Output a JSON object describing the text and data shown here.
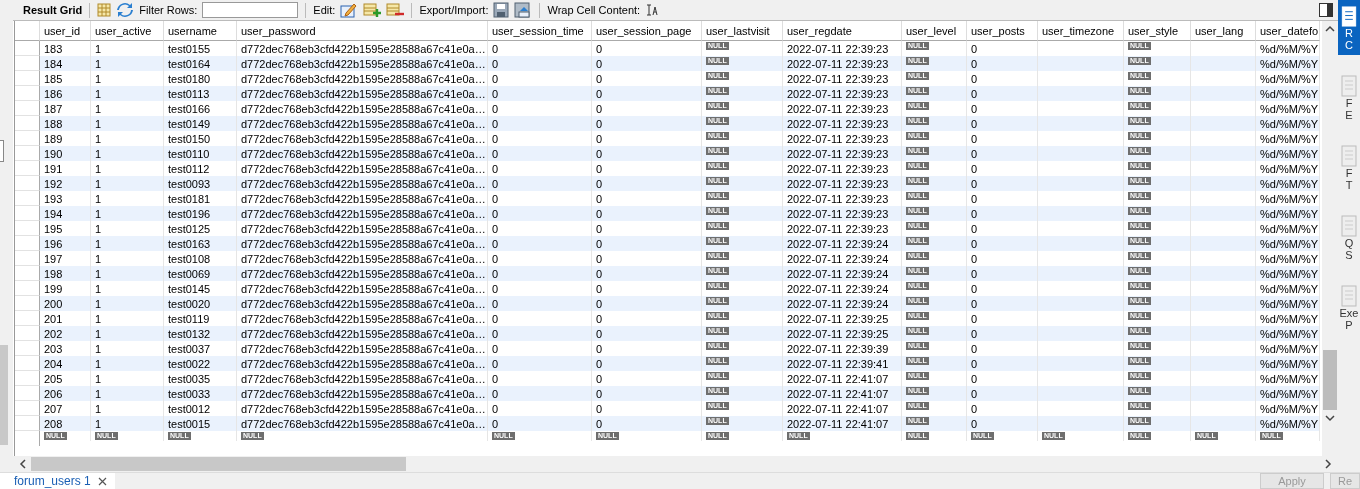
{
  "toolbar": {
    "title": "Result Grid",
    "filter_label": "Filter Rows:",
    "edit_label": "Edit:",
    "export_label": "Export/Import:",
    "wrap_label": "Wrap Cell Content:"
  },
  "columns": [
    "user_id",
    "user_active",
    "username",
    "user_password",
    "user_session_time",
    "user_session_page",
    "user_lastvisit",
    "user_regdate",
    "user_level",
    "user_posts",
    "user_timezone",
    "user_style",
    "user_lang",
    "user_datefo"
  ],
  "rows": [
    [
      "183",
      "1",
      "test0155",
      "d772dec768eb3cfd422b1595e28588a67c41e0a…",
      "0",
      "0",
      {
        "kind": "null",
        "text": "NULL"
      },
      "2022-07-11 22:39:23",
      {
        "kind": "null",
        "text": "NULL"
      },
      "0",
      null,
      {
        "kind": "null",
        "text": "NULL"
      },
      null,
      "%d/%M/%Y"
    ],
    [
      "184",
      "1",
      "test0164",
      "d772dec768eb3cfd422b1595e28588a67c41e0a…",
      "0",
      "0",
      {
        "kind": "null",
        "text": "NULL"
      },
      "2022-07-11 22:39:23",
      {
        "kind": "null",
        "text": "NULL"
      },
      "0",
      null,
      {
        "kind": "null",
        "text": "NULL"
      },
      null,
      "%d/%M/%Y"
    ],
    [
      "185",
      "1",
      "test0180",
      "d772dec768eb3cfd422b1595e28588a67c41e0a…",
      "0",
      "0",
      {
        "kind": "null",
        "text": "NULL"
      },
      "2022-07-11 22:39:23",
      {
        "kind": "null",
        "text": "NULL"
      },
      "0",
      null,
      {
        "kind": "null",
        "text": "NULL"
      },
      null,
      "%d/%M/%Y"
    ],
    [
      "186",
      "1",
      "test0113",
      "d772dec768eb3cfd422b1595e28588a67c41e0a…",
      "0",
      "0",
      {
        "kind": "null",
        "text": "NULL"
      },
      "2022-07-11 22:39:23",
      {
        "kind": "null",
        "text": "NULL"
      },
      "0",
      null,
      {
        "kind": "null",
        "text": "NULL"
      },
      null,
      "%d/%M/%Y"
    ],
    [
      "187",
      "1",
      "test0166",
      "d772dec768eb3cfd422b1595e28588a67c41e0a…",
      "0",
      "0",
      {
        "kind": "null",
        "text": "NULL"
      },
      "2022-07-11 22:39:23",
      {
        "kind": "null",
        "text": "NULL"
      },
      "0",
      null,
      {
        "kind": "null",
        "text": "NULL"
      },
      null,
      "%d/%M/%Y"
    ],
    [
      "188",
      "1",
      "test0149",
      "d772dec768eb3cfd422b1595e28588a67c41e0a…",
      "0",
      "0",
      {
        "kind": "null",
        "text": "NULL"
      },
      "2022-07-11 22:39:23",
      {
        "kind": "null",
        "text": "NULL"
      },
      "0",
      null,
      {
        "kind": "null",
        "text": "NULL"
      },
      null,
      "%d/%M/%Y"
    ],
    [
      "189",
      "1",
      "test0150",
      "d772dec768eb3cfd422b1595e28588a67c41e0a…",
      "0",
      "0",
      {
        "kind": "null",
        "text": "NULL"
      },
      "2022-07-11 22:39:23",
      {
        "kind": "null",
        "text": "NULL"
      },
      "0",
      null,
      {
        "kind": "null",
        "text": "NULL"
      },
      null,
      "%d/%M/%Y"
    ],
    [
      "190",
      "1",
      "test0110",
      "d772dec768eb3cfd422b1595e28588a67c41e0a…",
      "0",
      "0",
      {
        "kind": "null",
        "text": "NULL"
      },
      "2022-07-11 22:39:23",
      {
        "kind": "null",
        "text": "NULL"
      },
      "0",
      null,
      {
        "kind": "null",
        "text": "NULL"
      },
      null,
      "%d/%M/%Y"
    ],
    [
      "191",
      "1",
      "test0112",
      "d772dec768eb3cfd422b1595e28588a67c41e0a…",
      "0",
      "0",
      {
        "kind": "null",
        "text": "NULL"
      },
      "2022-07-11 22:39:23",
      {
        "kind": "null",
        "text": "NULL"
      },
      "0",
      null,
      {
        "kind": "null",
        "text": "NULL"
      },
      null,
      "%d/%M/%Y"
    ],
    [
      "192",
      "1",
      "test0093",
      "d772dec768eb3cfd422b1595e28588a67c41e0a…",
      "0",
      "0",
      {
        "kind": "null",
        "text": "NULL"
      },
      "2022-07-11 22:39:23",
      {
        "kind": "null",
        "text": "NULL"
      },
      "0",
      null,
      {
        "kind": "null",
        "text": "NULL"
      },
      null,
      "%d/%M/%Y"
    ],
    [
      "193",
      "1",
      "test0181",
      "d772dec768eb3cfd422b1595e28588a67c41e0a…",
      "0",
      "0",
      {
        "kind": "null",
        "text": "NULL"
      },
      "2022-07-11 22:39:23",
      {
        "kind": "null",
        "text": "NULL"
      },
      "0",
      null,
      {
        "kind": "null",
        "text": "NULL"
      },
      null,
      "%d/%M/%Y"
    ],
    [
      "194",
      "1",
      "test0196",
      "d772dec768eb3cfd422b1595e28588a67c41e0a…",
      "0",
      "0",
      {
        "kind": "null",
        "text": "NULL"
      },
      "2022-07-11 22:39:23",
      {
        "kind": "null",
        "text": "NULL"
      },
      "0",
      null,
      {
        "kind": "null",
        "text": "NULL"
      },
      null,
      "%d/%M/%Y"
    ],
    [
      "195",
      "1",
      "test0125",
      "d772dec768eb3cfd422b1595e28588a67c41e0a…",
      "0",
      "0",
      {
        "kind": "null",
        "text": "NULL"
      },
      "2022-07-11 22:39:23",
      {
        "kind": "null",
        "text": "NULL"
      },
      "0",
      null,
      {
        "kind": "null",
        "text": "NULL"
      },
      null,
      "%d/%M/%Y"
    ],
    [
      "196",
      "1",
      "test0163",
      "d772dec768eb3cfd422b1595e28588a67c41e0a…",
      "0",
      "0",
      {
        "kind": "null",
        "text": "NULL"
      },
      "2022-07-11 22:39:24",
      {
        "kind": "null",
        "text": "NULL"
      },
      "0",
      null,
      {
        "kind": "null",
        "text": "NULL"
      },
      null,
      "%d/%M/%Y"
    ],
    [
      "197",
      "1",
      "test0108",
      "d772dec768eb3cfd422b1595e28588a67c41e0a…",
      "0",
      "0",
      {
        "kind": "null",
        "text": "NULL"
      },
      "2022-07-11 22:39:24",
      {
        "kind": "null",
        "text": "NULL"
      },
      "0",
      null,
      {
        "kind": "null",
        "text": "NULL"
      },
      null,
      "%d/%M/%Y"
    ],
    [
      "198",
      "1",
      "test0069",
      "d772dec768eb3cfd422b1595e28588a67c41e0a…",
      "0",
      "0",
      {
        "kind": "null",
        "text": "NULL"
      },
      "2022-07-11 22:39:24",
      {
        "kind": "null",
        "text": "NULL"
      },
      "0",
      null,
      {
        "kind": "null",
        "text": "NULL"
      },
      null,
      "%d/%M/%Y"
    ],
    [
      "199",
      "1",
      "test0145",
      "d772dec768eb3cfd422b1595e28588a67c41e0a…",
      "0",
      "0",
      {
        "kind": "null",
        "text": "NULL"
      },
      "2022-07-11 22:39:24",
      {
        "kind": "null",
        "text": "NULL"
      },
      "0",
      null,
      {
        "kind": "null",
        "text": "NULL"
      },
      null,
      "%d/%M/%Y"
    ],
    [
      "200",
      "1",
      "test0020",
      "d772dec768eb3cfd422b1595e28588a67c41e0a…",
      "0",
      "0",
      {
        "kind": "null",
        "text": "NULL"
      },
      "2022-07-11 22:39:24",
      {
        "kind": "null",
        "text": "NULL"
      },
      "0",
      null,
      {
        "kind": "null",
        "text": "NULL"
      },
      null,
      "%d/%M/%Y"
    ],
    [
      "201",
      "1",
      "test0119",
      "d772dec768eb3cfd422b1595e28588a67c41e0a…",
      "0",
      "0",
      {
        "kind": "null",
        "text": "NULL"
      },
      "2022-07-11 22:39:25",
      {
        "kind": "null",
        "text": "NULL"
      },
      "0",
      null,
      {
        "kind": "null",
        "text": "NULL"
      },
      null,
      "%d/%M/%Y"
    ],
    [
      "202",
      "1",
      "test0132",
      "d772dec768eb3cfd422b1595e28588a67c41e0a…",
      "0",
      "0",
      {
        "kind": "null",
        "text": "NULL"
      },
      "2022-07-11 22:39:25",
      {
        "kind": "null",
        "text": "NULL"
      },
      "0",
      null,
      {
        "kind": "null",
        "text": "NULL"
      },
      null,
      "%d/%M/%Y"
    ],
    [
      "203",
      "1",
      "test0037",
      "d772dec768eb3cfd422b1595e28588a67c41e0a…",
      "0",
      "0",
      {
        "kind": "null",
        "text": "NULL"
      },
      "2022-07-11 22:39:39",
      {
        "kind": "null",
        "text": "NULL"
      },
      "0",
      null,
      {
        "kind": "null",
        "text": "NULL"
      },
      null,
      "%d/%M/%Y"
    ],
    [
      "204",
      "1",
      "test0022",
      "d772dec768eb3cfd422b1595e28588a67c41e0a…",
      "0",
      "0",
      {
        "kind": "null",
        "text": "NULL"
      },
      "2022-07-11 22:39:41",
      {
        "kind": "null",
        "text": "NULL"
      },
      "0",
      null,
      {
        "kind": "null",
        "text": "NULL"
      },
      null,
      "%d/%M/%Y"
    ],
    [
      "205",
      "1",
      "test0035",
      "d772dec768eb3cfd422b1595e28588a67c41e0a…",
      "0",
      "0",
      {
        "kind": "null",
        "text": "NULL"
      },
      "2022-07-11 22:41:07",
      {
        "kind": "null",
        "text": "NULL"
      },
      "0",
      null,
      {
        "kind": "null",
        "text": "NULL"
      },
      null,
      "%d/%M/%Y"
    ],
    [
      "206",
      "1",
      "test0033",
      "d772dec768eb3cfd422b1595e28588a67c41e0a…",
      "0",
      "0",
      {
        "kind": "null",
        "text": "NULL"
      },
      "2022-07-11 22:41:07",
      {
        "kind": "null",
        "text": "NULL"
      },
      "0",
      null,
      {
        "kind": "null",
        "text": "NULL"
      },
      null,
      "%d/%M/%Y"
    ],
    [
      "207",
      "1",
      "test0012",
      "d772dec768eb3cfd422b1595e28588a67c41e0a…",
      "0",
      "0",
      {
        "kind": "null",
        "text": "NULL"
      },
      "2022-07-11 22:41:07",
      {
        "kind": "null",
        "text": "NULL"
      },
      "0",
      null,
      {
        "kind": "null",
        "text": "NULL"
      },
      null,
      "%d/%M/%Y"
    ],
    [
      "208",
      "1",
      "test0015",
      "d772dec768eb3cfd422b1595e28588a67c41e0a…",
      "0",
      "0",
      {
        "kind": "null",
        "text": "NULL"
      },
      "2022-07-11 22:41:07",
      {
        "kind": "null",
        "text": "NULL"
      },
      "0",
      null,
      {
        "kind": "null",
        "text": "NULL"
      },
      null,
      "%d/%M/%Y"
    ],
    [
      {
        "kind": "null",
        "text": "NULL"
      },
      {
        "kind": "null",
        "text": "NULL"
      },
      {
        "kind": "null",
        "text": "NULL"
      },
      {
        "kind": "null",
        "text": "NULL"
      },
      {
        "kind": "null",
        "text": "NULL"
      },
      {
        "kind": "null",
        "text": "NULL"
      },
      {
        "kind": "null",
        "text": "NULL"
      },
      {
        "kind": "null",
        "text": "NULL"
      },
      {
        "kind": "null",
        "text": "NULL"
      },
      {
        "kind": "null",
        "text": "NULL"
      },
      {
        "kind": "null",
        "text": "NULL"
      },
      {
        "kind": "null",
        "text": "NULL"
      },
      {
        "kind": "null",
        "text": "NULL"
      },
      {
        "kind": "null",
        "text": "NULL"
      }
    ]
  ],
  "tabs": [
    {
      "label": "forum_users 1",
      "selected": true
    }
  ],
  "buttons": [
    {
      "label": "Apply",
      "disabled": true
    },
    {
      "label": "Re",
      "disabled": true
    }
  ],
  "side_panel": [
    {
      "lines": [
        "R",
        "C"
      ],
      "selected": true
    },
    {
      "lines": [
        "F",
        "E"
      ],
      "selected": false
    },
    {
      "lines": [
        "F",
        "T"
      ],
      "selected": false
    },
    {
      "lines": [
        "Q",
        "S"
      ],
      "selected": false
    },
    {
      "lines": [
        "Exe",
        "P"
      ],
      "selected": false
    }
  ]
}
